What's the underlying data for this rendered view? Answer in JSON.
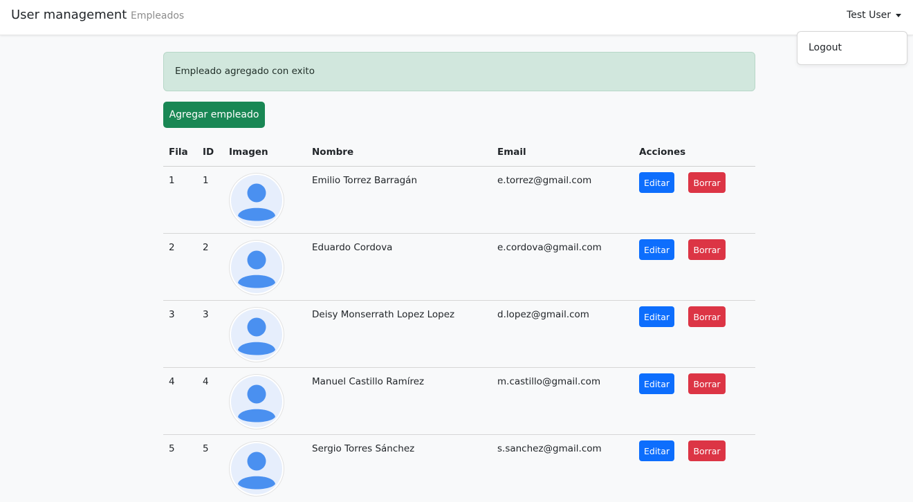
{
  "navbar": {
    "brand": "User management",
    "nav_link": "Empleados",
    "user": "Test User"
  },
  "dropdown": {
    "items": [
      {
        "label": "Logout"
      }
    ]
  },
  "alert": {
    "message": "Empleado agregado con exito"
  },
  "toolbar": {
    "add_label": "Agregar empleado"
  },
  "table": {
    "headers": [
      "Fila",
      "ID",
      "Imagen",
      "Nombre",
      "Email",
      "Acciones"
    ],
    "rows": [
      {
        "fila": "1",
        "id": "1",
        "nombre": "Emilio Torrez Barragán",
        "email": "e.torrez@gmail.com",
        "edit": "Editar",
        "delete": "Borrar"
      },
      {
        "fila": "2",
        "id": "2",
        "nombre": "Eduardo Cordova",
        "email": "e.cordova@gmail.com",
        "edit": "Editar",
        "delete": "Borrar"
      },
      {
        "fila": "3",
        "id": "3",
        "nombre": "Deisy Monserrath Lopez Lopez",
        "email": "d.lopez@gmail.com",
        "edit": "Editar",
        "delete": "Borrar"
      },
      {
        "fila": "4",
        "id": "4",
        "nombre": "Manuel Castillo Ramírez",
        "email": "m.castillo@gmail.com",
        "edit": "Editar",
        "delete": "Borrar"
      },
      {
        "fila": "5",
        "id": "5",
        "nombre": "Sergio Torres Sánchez",
        "email": "s.sanchez@gmail.com",
        "edit": "Editar",
        "delete": "Borrar"
      }
    ]
  },
  "colors": {
    "success": "#198754",
    "primary": "#0d6efd",
    "danger": "#dc3545",
    "alert_bg": "#d1e7dd",
    "avatar_blue": "#4a90f0",
    "avatar_bg": "#e6eefc"
  },
  "icons": {
    "avatar": "user-avatar-icon",
    "caret": "caret-down-icon"
  }
}
